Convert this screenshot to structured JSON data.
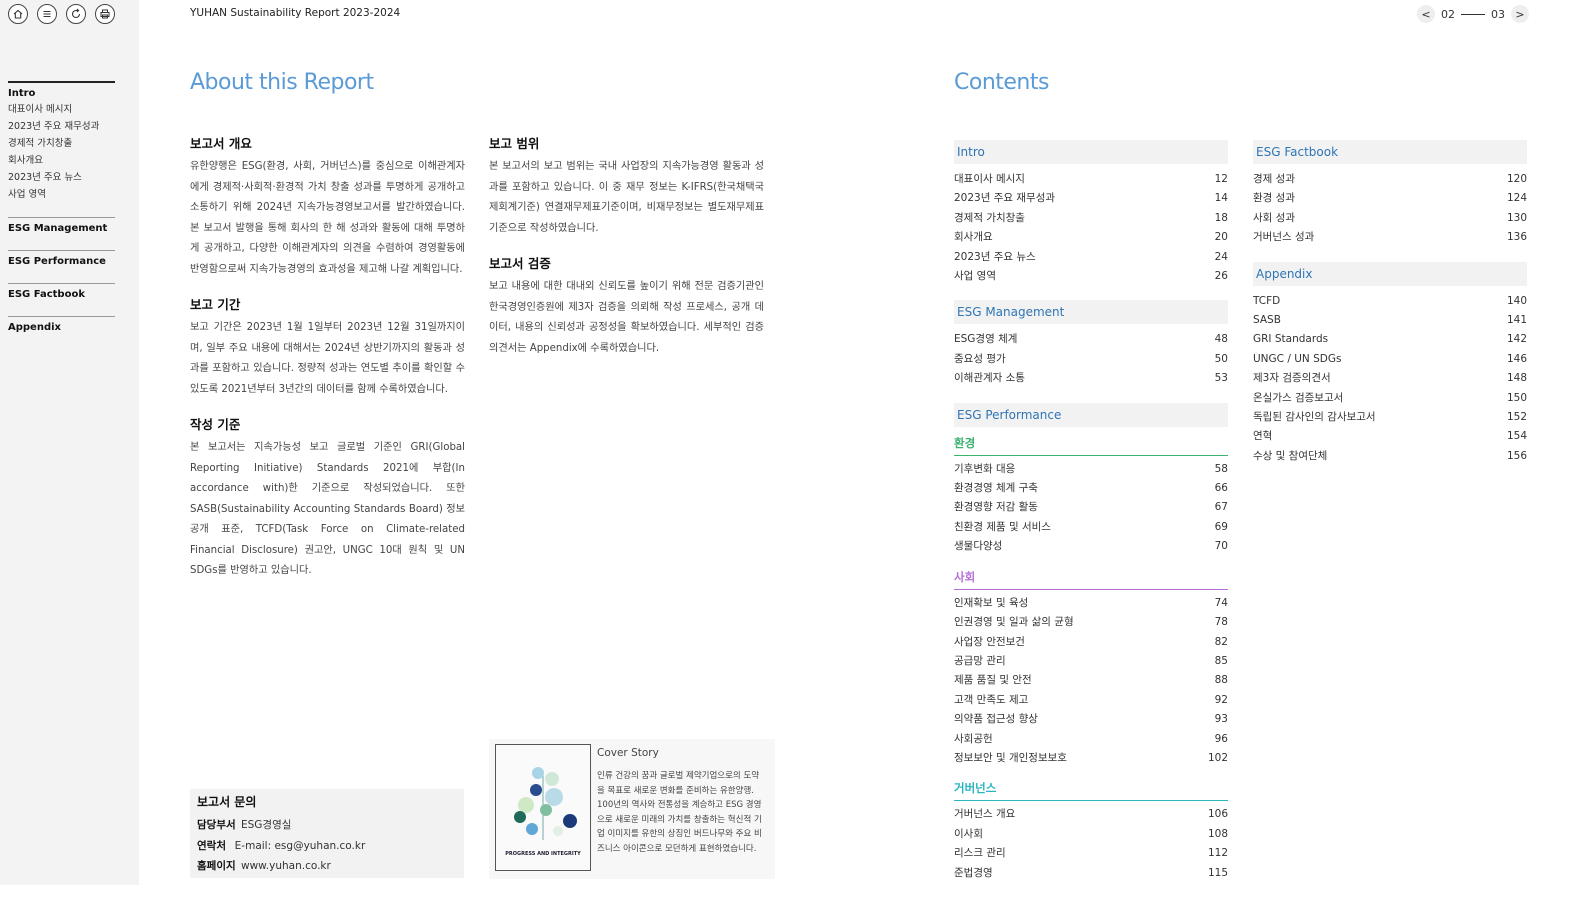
{
  "header": {
    "title": "YUHAN Sustainability Report 2023-2024",
    "pager": {
      "prev": "<",
      "page_left": "02",
      "page_right": "03",
      "next": ">"
    }
  },
  "sidebar": {
    "groups": [
      {
        "title": "Intro",
        "items": [
          "대표이사 메시지",
          "2023년 주요 재무성과",
          "경제적 가치창출",
          "회사개요",
          "2023년 주요 뉴스",
          "사업 영역"
        ]
      },
      {
        "title": "ESG Management",
        "items": []
      },
      {
        "title": "ESG Performance",
        "items": []
      },
      {
        "title": "ESG Factbook",
        "items": []
      },
      {
        "title": "Appendix",
        "items": []
      }
    ]
  },
  "about": {
    "title": "About this Report",
    "sections": [
      {
        "heading": "보고서 개요",
        "body": "유한양행은 ESG(환경, 사회, 거버넌스)를 중심으로 이해관계자에게 경제적·사회적·환경적 가치 창출 성과를 투명하게 공개하고 소통하기 위해 2024년 지속가능경영보고서를 발간하였습니다. 본 보고서 발행을 통해 회사의 한 해 성과와 활동에 대해 투명하게 공개하고, 다양한 이해관계자의 의견을 수렴하여 경영활동에 반영함으로써 지속가능경영의 효과성을 제고해 나갈 계획입니다."
      },
      {
        "heading": "보고 기간",
        "body": "보고 기간은 2023년 1월 1일부터 2023년 12월 31일까지이며, 일부 주요 내용에 대해서는 2024년 상반기까지의 활동과 성과를 포함하고 있습니다. 정량적 성과는 연도별 추이를 확인할 수 있도록 2021년부터 3년간의 데이터를 함께 수록하였습니다."
      },
      {
        "heading": "작성 기준",
        "body": "본 보고서는 지속가능성 보고 글로벌 기준인 GRI(Global Reporting Initiative) Standards 2021에 부합(In accordance with)한 기준으로 작성되었습니다. 또한 SASB(Sustainability Accounting Standards Board) 정보공개 표준, TCFD(Task Force on Climate-related Financial Disclosure) 권고안, UNGC 10대 원칙 및 UN SDGs를 반영하고 있습니다."
      },
      {
        "heading": "보고 범위",
        "body": "본 보고서의 보고 범위는 국내 사업장의 지속가능경영 활동과 성과를 포함하고 있습니다. 이 중 재무 정보는 K-IFRS(한국채택국제회계기준) 연결재무제표기준이며, 비재무정보는 별도재무제표기준으로 작성하였습니다."
      },
      {
        "heading": "보고서 검증",
        "body": "보고 내용에 대한 대내외 신뢰도를 높이기 위해 전문 검증기관인 한국경영인증원에 제3자 검증을 의뢰해 작성 프로세스, 공개 데이터, 내용의 신뢰성과 공정성을 확보하였습니다. 세부적인 검증의견서는 Appendix에 수록하였습니다."
      }
    ],
    "contact": {
      "title": "보고서 문의",
      "dept_label": "담당부서",
      "dept": "ESG경영실",
      "tel_label": "연락처",
      "tel": "E-mail: esg@yuhan.co.kr",
      "web_label": "홈페이지",
      "web": "www.yuhan.co.kr"
    },
    "cover": {
      "title": "Cover Story",
      "image_caption": "PROGRESS AND INTEGRITY",
      "text": "인류 건강의 꿈과 글로벌 제약기업으로의 도약을 목표로 새로운 변화를 준비하는 유한양행. 100년의 역사와 전통성을 계승하고 ESG 경영으로 새로운 미래의 가치를 창출하는 혁신적 기업 이미지를 유한의 상징인 버드나무와 주요 비즈니스 아이콘으로 모던하게 표현하였습니다."
    }
  },
  "contents": {
    "title": "Contents",
    "left": [
      {
        "head": "Intro",
        "rows": [
          [
            "대표이사 메시지",
            "12"
          ],
          [
            "2023년 주요 재무성과",
            "14"
          ],
          [
            "경제적 가치창출",
            "18"
          ],
          [
            "회사개요",
            "20"
          ],
          [
            "2023년 주요 뉴스",
            "24"
          ],
          [
            "사업 영역",
            "26"
          ]
        ]
      },
      {
        "head": "ESG Management",
        "rows": [
          [
            "ESG경영 체계",
            "48"
          ],
          [
            "중요성 평가",
            "50"
          ],
          [
            "이해관계자 소통",
            "53"
          ]
        ]
      },
      {
        "head": "ESG Performance",
        "subs": [
          {
            "name": "환경",
            "color": "#3cb371",
            "rows": [
              [
                "기후변화 대응",
                "58"
              ],
              [
                "환경경영 체계 구축",
                "66"
              ],
              [
                "환경영향 저감 활동",
                "67"
              ],
              [
                "친환경 제품 및 서비스",
                "69"
              ],
              [
                "생물다양성",
                "70"
              ]
            ]
          },
          {
            "name": "사회",
            "color": "#b56fd6",
            "rows": [
              [
                "인재확보 및 육성",
                "74"
              ],
              [
                "인권경영 및 일과 삶의 균형",
                "78"
              ],
              [
                "사업장 안전보건",
                "82"
              ],
              [
                "공급망 관리",
                "85"
              ],
              [
                "제품 품질 및 안전",
                "88"
              ],
              [
                "고객 만족도 제고",
                "92"
              ],
              [
                "의약품 접근성 향상",
                "93"
              ],
              [
                "사회공헌",
                "96"
              ],
              [
                "정보보안 및 개인정보보호",
                "102"
              ]
            ]
          },
          {
            "name": "거버넌스",
            "color": "#2bb5c0",
            "rows": [
              [
                "거버넌스 개요",
                "106"
              ],
              [
                "이사회",
                "108"
              ],
              [
                "리스크 관리",
                "112"
              ],
              [
                "준법경영",
                "115"
              ]
            ]
          }
        ]
      }
    ],
    "right": [
      {
        "head": "ESG Factbook",
        "rows": [
          [
            "경제 성과",
            "120"
          ],
          [
            "환경 성과",
            "124"
          ],
          [
            "사회 성과",
            "130"
          ],
          [
            "거버넌스 성과",
            "136"
          ]
        ]
      },
      {
        "head": "Appendix",
        "rows": [
          [
            "TCFD",
            "140"
          ],
          [
            "SASB",
            "141"
          ],
          [
            "GRI Standards",
            "142"
          ],
          [
            "UNGC / UN SDGs",
            "146"
          ],
          [
            "제3자 검증의견서",
            "148"
          ],
          [
            "온실가스 검증보고서",
            "150"
          ],
          [
            "독립된 감사인의 감사보고서",
            "152"
          ],
          [
            "연혁",
            "154"
          ],
          [
            "수상 및 참여단체",
            "156"
          ]
        ]
      }
    ]
  }
}
